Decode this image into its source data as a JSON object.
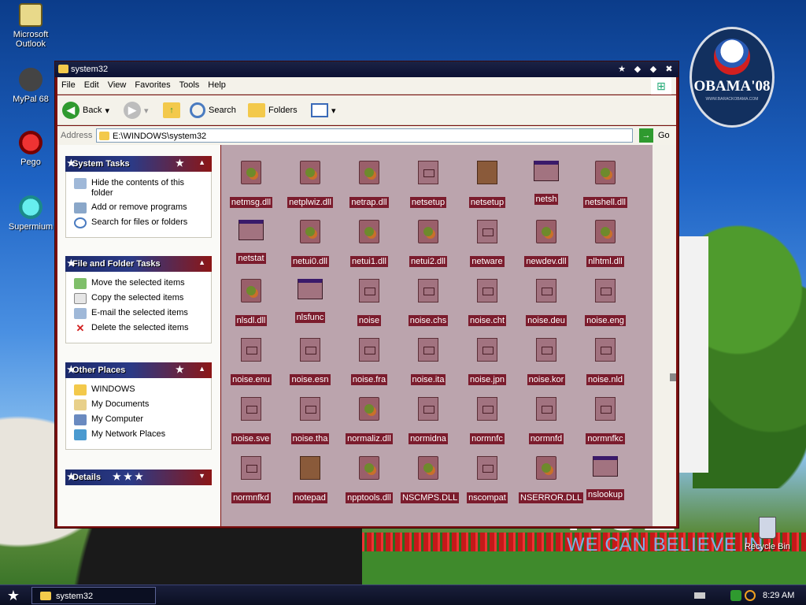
{
  "desktop": {
    "icons": [
      {
        "label": "Microsoft Outlook"
      },
      {
        "label": "MyPal 68"
      },
      {
        "label": "Pego"
      },
      {
        "label": "Supermium"
      }
    ],
    "recycle_bin": "Recycle Bin",
    "wallpaper": {
      "badge_text": "OBAMA'08",
      "badge_sub": "WWW.BARACKOBAMA.COM",
      "slogan_big": "NGE",
      "slogan_small": "WE CAN BELIEVE IN"
    }
  },
  "window": {
    "title": "system32",
    "title_buttons": {
      "minimize": "◆",
      "maximize": "◆",
      "close": "✖",
      "star": "★"
    },
    "menu": [
      "File",
      "Edit",
      "View",
      "Favorites",
      "Tools",
      "Help"
    ],
    "toolbar": {
      "back": "Back",
      "search": "Search",
      "folders": "Folders"
    },
    "address": {
      "label": "Address",
      "value": "E:\\WINDOWS\\system32",
      "go": "Go"
    },
    "tasks": {
      "system": {
        "title": "System Tasks",
        "items": [
          "Hide the contents of this folder",
          "Add or remove programs",
          "Search for files or folders"
        ]
      },
      "file_folder": {
        "title": "File and Folder Tasks",
        "items": [
          "Move the selected items",
          "Copy the selected items",
          "E-mail the selected items",
          "Delete the selected items"
        ]
      },
      "other": {
        "title": "Other Places",
        "items": [
          "WINDOWS",
          "My Documents",
          "My Computer",
          "My Network Places"
        ]
      },
      "details": {
        "title": "Details"
      }
    },
    "files": [
      {
        "name": "netmsg.dll",
        "type": "dll"
      },
      {
        "name": "netplwiz.dll",
        "type": "dll"
      },
      {
        "name": "netrap.dll",
        "type": "dll"
      },
      {
        "name": "netsetup",
        "type": "file"
      },
      {
        "name": "netsetup",
        "type": "box"
      },
      {
        "name": "netsh",
        "type": "exe"
      },
      {
        "name": "netshell.dll",
        "type": "dll"
      },
      {
        "name": "netstat",
        "type": "exe"
      },
      {
        "name": "netui0.dll",
        "type": "dll"
      },
      {
        "name": "netui1.dll",
        "type": "dll"
      },
      {
        "name": "netui2.dll",
        "type": "dll"
      },
      {
        "name": "netware",
        "type": "file"
      },
      {
        "name": "newdev.dll",
        "type": "dll"
      },
      {
        "name": "nlhtml.dll",
        "type": "dll"
      },
      {
        "name": "nlsdl.dll",
        "type": "dll"
      },
      {
        "name": "nlsfunc",
        "type": "exe"
      },
      {
        "name": "noise",
        "type": "file"
      },
      {
        "name": "noise.chs",
        "type": "file"
      },
      {
        "name": "noise.cht",
        "type": "file"
      },
      {
        "name": "noise.deu",
        "type": "file"
      },
      {
        "name": "noise.eng",
        "type": "file"
      },
      {
        "name": "noise.enu",
        "type": "file"
      },
      {
        "name": "noise.esn",
        "type": "file"
      },
      {
        "name": "noise.fra",
        "type": "file"
      },
      {
        "name": "noise.ita",
        "type": "file"
      },
      {
        "name": "noise.jpn",
        "type": "file"
      },
      {
        "name": "noise.kor",
        "type": "file"
      },
      {
        "name": "noise.nld",
        "type": "file"
      },
      {
        "name": "noise.sve",
        "type": "file"
      },
      {
        "name": "noise.tha",
        "type": "file"
      },
      {
        "name": "normaliz.dll",
        "type": "dll"
      },
      {
        "name": "normidna",
        "type": "file"
      },
      {
        "name": "normnfc",
        "type": "file"
      },
      {
        "name": "normnfd",
        "type": "file"
      },
      {
        "name": "normnfkc",
        "type": "file"
      },
      {
        "name": "normnfkd",
        "type": "file"
      },
      {
        "name": "notepad",
        "type": "box"
      },
      {
        "name": "npptools.dll",
        "type": "dll"
      },
      {
        "name": "NSCMPS.DLL",
        "type": "dll"
      },
      {
        "name": "nscompat",
        "type": "file"
      },
      {
        "name": "NSERROR.DLL",
        "type": "dll"
      },
      {
        "name": "nslookup",
        "type": "exe"
      }
    ]
  },
  "taskbar": {
    "task": "system32",
    "clock": "8:29 AM"
  },
  "colors": {
    "window_frame": "#7a0f0f",
    "file_area": "#bba4ad",
    "label_bg": "#7b1c2d",
    "panel_head": "#1c2a6b"
  }
}
